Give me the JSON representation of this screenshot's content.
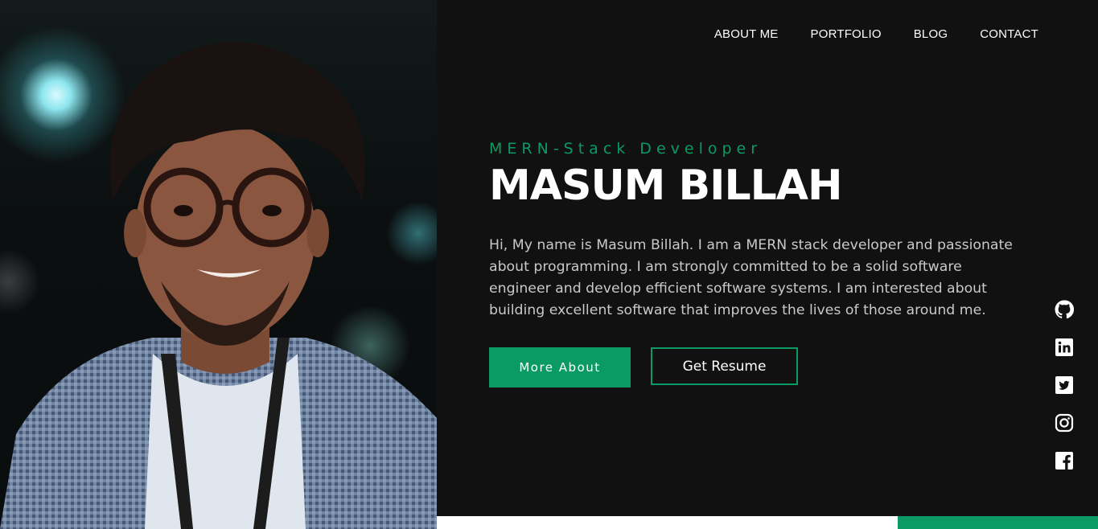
{
  "nav": {
    "items": [
      {
        "label": "ABOUT ME"
      },
      {
        "label": "PORTFOLIO"
      },
      {
        "label": "BLOG"
      },
      {
        "label": "CONTACT"
      }
    ]
  },
  "hero": {
    "role": "MERN-Stack Developer",
    "name": "MASUM BILLAH",
    "bio": "Hi, My name is Masum Billah. I am a MERN stack developer and passionate about programming. I am strongly committed to be a solid software engineer and develop efficient software systems. I am interested about building excellent software that improves the lives of those around me.",
    "more_about_label": "More About",
    "resume_label": "Get Resume"
  },
  "social": {
    "icons": [
      "github-icon",
      "linkedin-icon",
      "twitter-icon",
      "instagram-icon",
      "facebook-icon"
    ]
  },
  "colors": {
    "accent": "#0a9a63",
    "background": "#111111",
    "text": "#ffffff",
    "muted_text": "#c9c9c9"
  }
}
